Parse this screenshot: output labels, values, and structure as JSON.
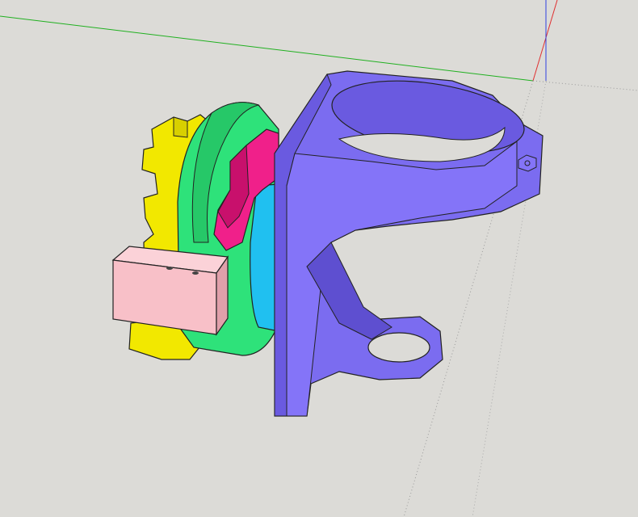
{
  "viewport": {
    "background": "#dcdbd7",
    "axes": {
      "x_color": "#e03030",
      "y_color": "#20b020",
      "z_color": "#3040e0"
    },
    "parts": [
      {
        "name": "bracket",
        "color": "#7b6cf0"
      },
      {
        "name": "yellow-gear-part",
        "color": "#f2e800"
      },
      {
        "name": "green-disc",
        "color": "#2ee27a"
      },
      {
        "name": "magenta-lever",
        "color": "#f0208a"
      },
      {
        "name": "cyan-spacer",
        "color": "#20c0f0"
      },
      {
        "name": "pink-block",
        "color": "#f8c0c8"
      }
    ]
  }
}
